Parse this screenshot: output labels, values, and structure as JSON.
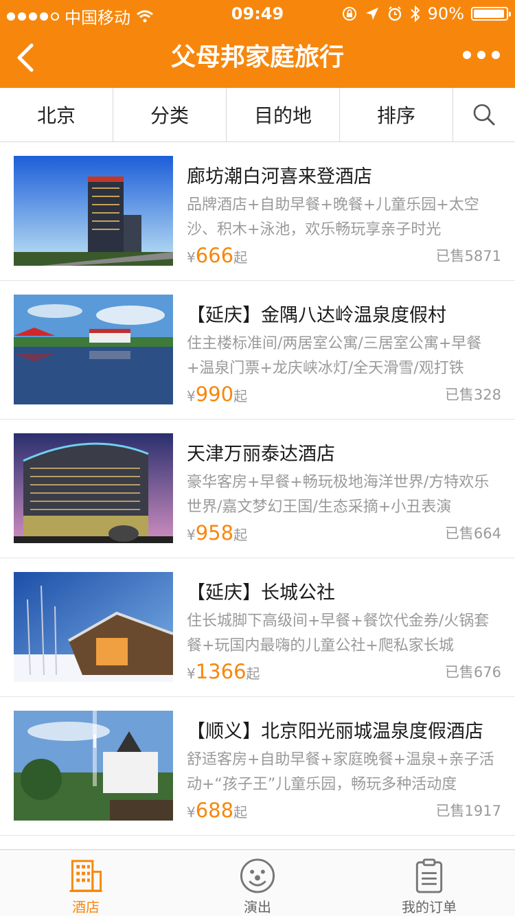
{
  "status_bar": {
    "carrier": "中国移动",
    "time": "09:49",
    "battery": "90%",
    "battery_level": 0.9
  },
  "nav": {
    "title": "父母邦家庭旅行",
    "back_icon": "chevron-left-icon",
    "more_icon": "more-dots-icon"
  },
  "filters": [
    {
      "label": "北京"
    },
    {
      "label": "分类"
    },
    {
      "label": "目的地"
    },
    {
      "label": "排序"
    }
  ],
  "search_icon": "search-icon",
  "currency": "¥",
  "price_suffix": "起",
  "items": [
    {
      "name": "廊坊潮白河喜来登酒店",
      "desc": "品牌酒店+自助早餐+晚餐+儿童乐园+太空沙、积木+泳池，欢乐畅玩享亲子时光",
      "price": "666",
      "sold": "已售5871"
    },
    {
      "name": "【延庆】金隅八达岭温泉度假村",
      "desc": "住主楼标准间/两居室公寓/三居室公寓+早餐+温泉门票+龙庆峡冰灯/全天滑雪/观打铁",
      "price": "990",
      "sold": "已售328"
    },
    {
      "name": "天津万丽泰达酒店",
      "desc": "豪华客房+早餐+畅玩极地海洋世界/方特欢乐世界/嘉文梦幻王国/生态采摘+小丑表演",
      "price": "958",
      "sold": "已售664"
    },
    {
      "name": "【延庆】长城公社",
      "desc": "住长城脚下高级间+早餐+餐饮代金券/火锅套餐+玩国内最嗨的儿童公社+爬私家长城",
      "price": "1366",
      "sold": "已售676"
    },
    {
      "name": "【顺义】北京阳光丽城温泉度假酒店",
      "desc": "舒适客房+自助早餐+家庭晚餐+温泉+亲子活动+“孩子王”儿童乐园，畅玩多种活动度",
      "price": "688",
      "sold": "已售1917"
    }
  ],
  "tabs": [
    {
      "label": "酒店",
      "icon": "hotel-building-icon",
      "active": true
    },
    {
      "label": "演出",
      "icon": "clown-face-icon",
      "active": false
    },
    {
      "label": "我的订单",
      "icon": "clipboard-orders-icon",
      "active": false
    }
  ],
  "colors": {
    "brand": "#f7870c",
    "muted": "#9a9a9a"
  }
}
